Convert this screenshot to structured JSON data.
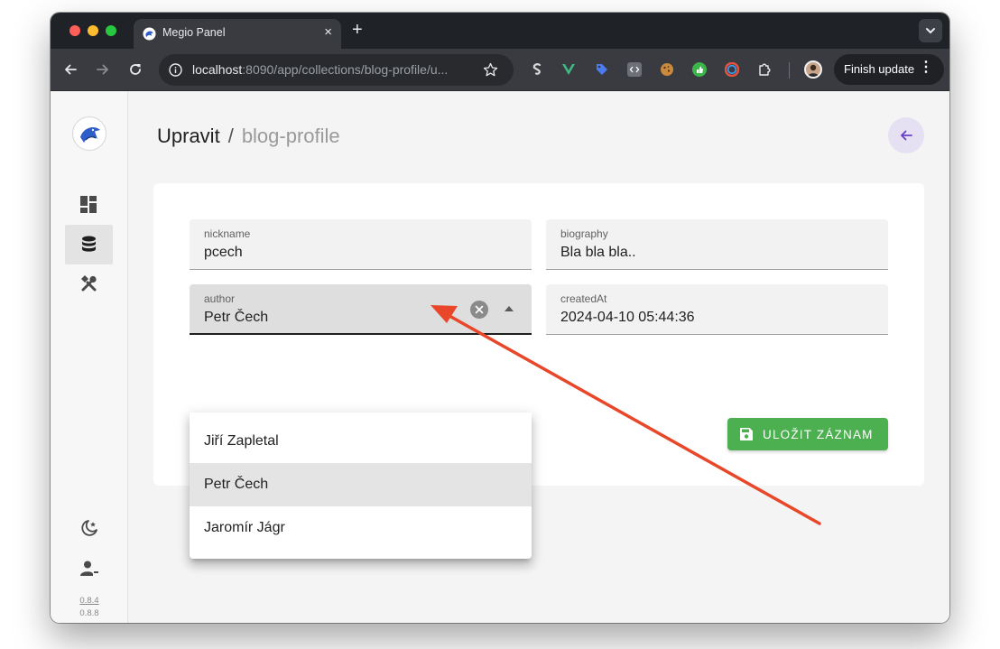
{
  "browser": {
    "tab_title": "Megio Panel",
    "tab_close": "×",
    "new_tab": "+",
    "url_host": "localhost",
    "url_path": ":8090/app/collections/blog-profile/u...",
    "finish_update_label": "Finish update",
    "menu_glyph": "⋮"
  },
  "sidebar": {
    "items": [
      {
        "icon": "dashboard-icon"
      },
      {
        "icon": "database-icon",
        "active": true
      },
      {
        "icon": "tools-icon"
      }
    ],
    "bottom_icons": [
      "theme-moon-icon",
      "user-logout-icon"
    ],
    "version_app": "0.8.4",
    "version_lib": "0.8.8"
  },
  "page": {
    "title": "Upravit",
    "separator": "/",
    "collection": "blog-profile"
  },
  "form": {
    "nickname": {
      "label": "nickname",
      "value": "pcech"
    },
    "biography": {
      "label": "biography",
      "value": "Bla bla bla.."
    },
    "author": {
      "label": "author",
      "value": "Petr Čech",
      "options": [
        "Jiří Zapletal",
        "Petr Čech",
        "Jaromír Jágr"
      ],
      "selected_index": 1
    },
    "createdAt": {
      "label": "createdAt",
      "value": "2024-04-10 05:44:36"
    },
    "save_label": "ULOŽIT ZÁZNAM"
  },
  "colors": {
    "accent": "#4caf50",
    "back_button_bg": "#e6e0f3",
    "back_arrow": "#6a3fc8",
    "annotation_arrow": "#e8472a"
  }
}
